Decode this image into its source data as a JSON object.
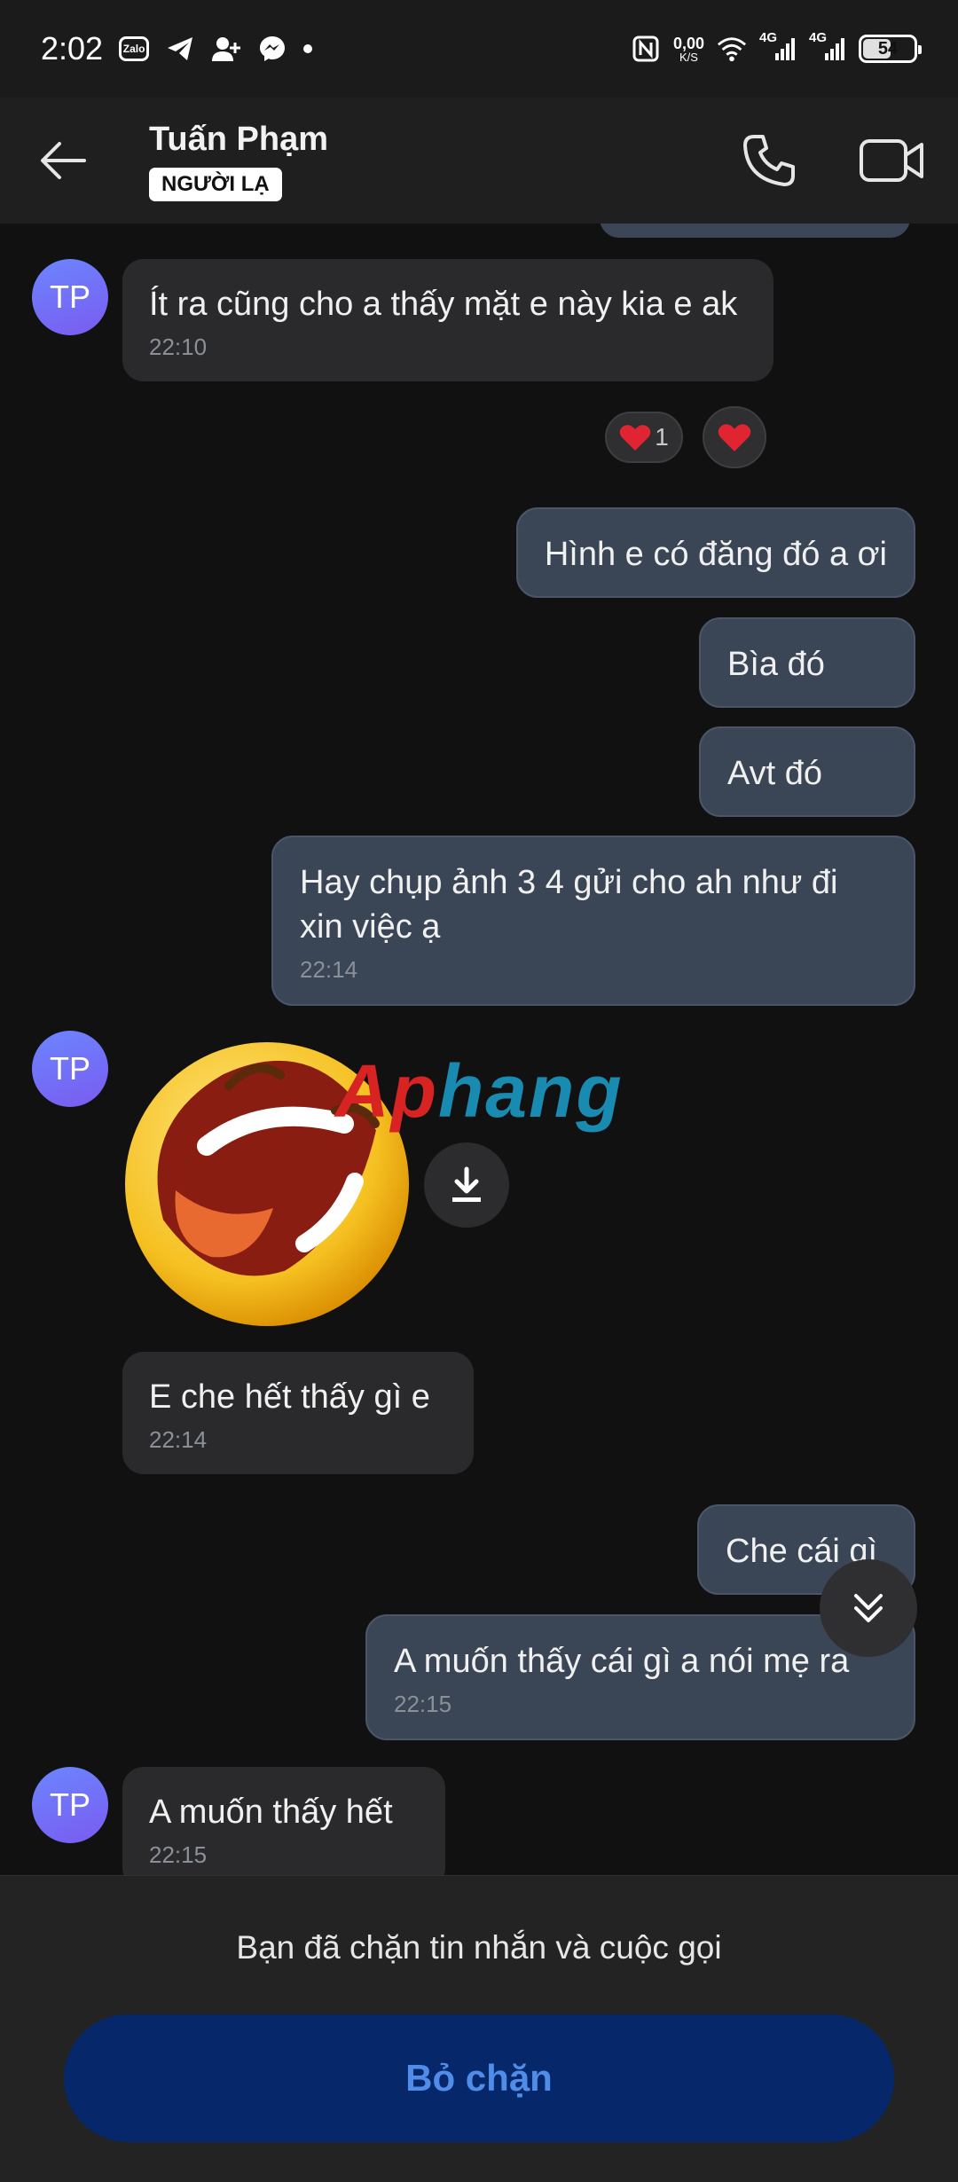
{
  "status_bar": {
    "time": "2:02",
    "zalo_label": "Zalo",
    "net_speed_value": "0,00",
    "net_speed_unit": "K/S",
    "network_1": "4G",
    "network_2": "4G",
    "battery": "54",
    "battery_level": 0.54
  },
  "header": {
    "contact_name": "Tuấn Phạm",
    "tag": "NGƯỜI LẠ"
  },
  "avatar_initials": "TP",
  "messages": [
    {
      "dir": "in",
      "text": "Ít ra cũng cho a thấy mặt e này kia e ak",
      "time": "22:10"
    },
    {
      "dir": "out",
      "text": "Hình e có đăng đó a ơi"
    },
    {
      "dir": "out",
      "text": "Bìa đó"
    },
    {
      "dir": "out",
      "text": "Avt đó"
    },
    {
      "dir": "out",
      "text": "Hay chụp ảnh 3 4 gửi cho ah như đi xin việc ạ",
      "time": "22:14"
    },
    {
      "dir": "in",
      "text": "E che hết thấy gì e",
      "time": "22:14"
    },
    {
      "dir": "out",
      "text": "Che cái gì"
    },
    {
      "dir": "out",
      "text": "A muốn thấy cái gì a nói mẹ ra",
      "time": "22:15"
    },
    {
      "dir": "in",
      "text": "A muốn thấy hết",
      "time": "22:15"
    }
  ],
  "reactions": {
    "heart_count": "1"
  },
  "watermark": {
    "part1": "Ap",
    "part2": "hang"
  },
  "footer": {
    "blocked_notice": "Bạn đã chặn tin nhắn và cuộc gọi",
    "unblock_label": "Bỏ chặn"
  }
}
